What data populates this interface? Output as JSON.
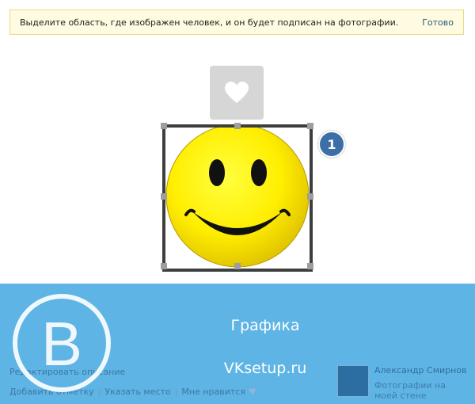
{
  "notice": {
    "text": "Выделите область, где изображен человек, и он будет подписан на фотографии.",
    "done_label": "Готово"
  },
  "tag_icon": "heart-icon",
  "badge": {
    "number": "1"
  },
  "footer": {
    "title": "Графика",
    "site": "VKsetup.ru",
    "edit_description": "Редактировать описание",
    "links": {
      "add_mark": "Добавить отметку",
      "place": "Указать место",
      "like": "Мне нравится"
    },
    "author": {
      "name": "Александр Смирнов",
      "subtitle": "Фотографии на моей стене"
    }
  },
  "colors": {
    "notice_bg": "#fffbe0",
    "footer_bg": "#5eb4e4",
    "link": "#3d78a6",
    "badge": "#3d6fa6",
    "smiley": "#ffee00"
  }
}
